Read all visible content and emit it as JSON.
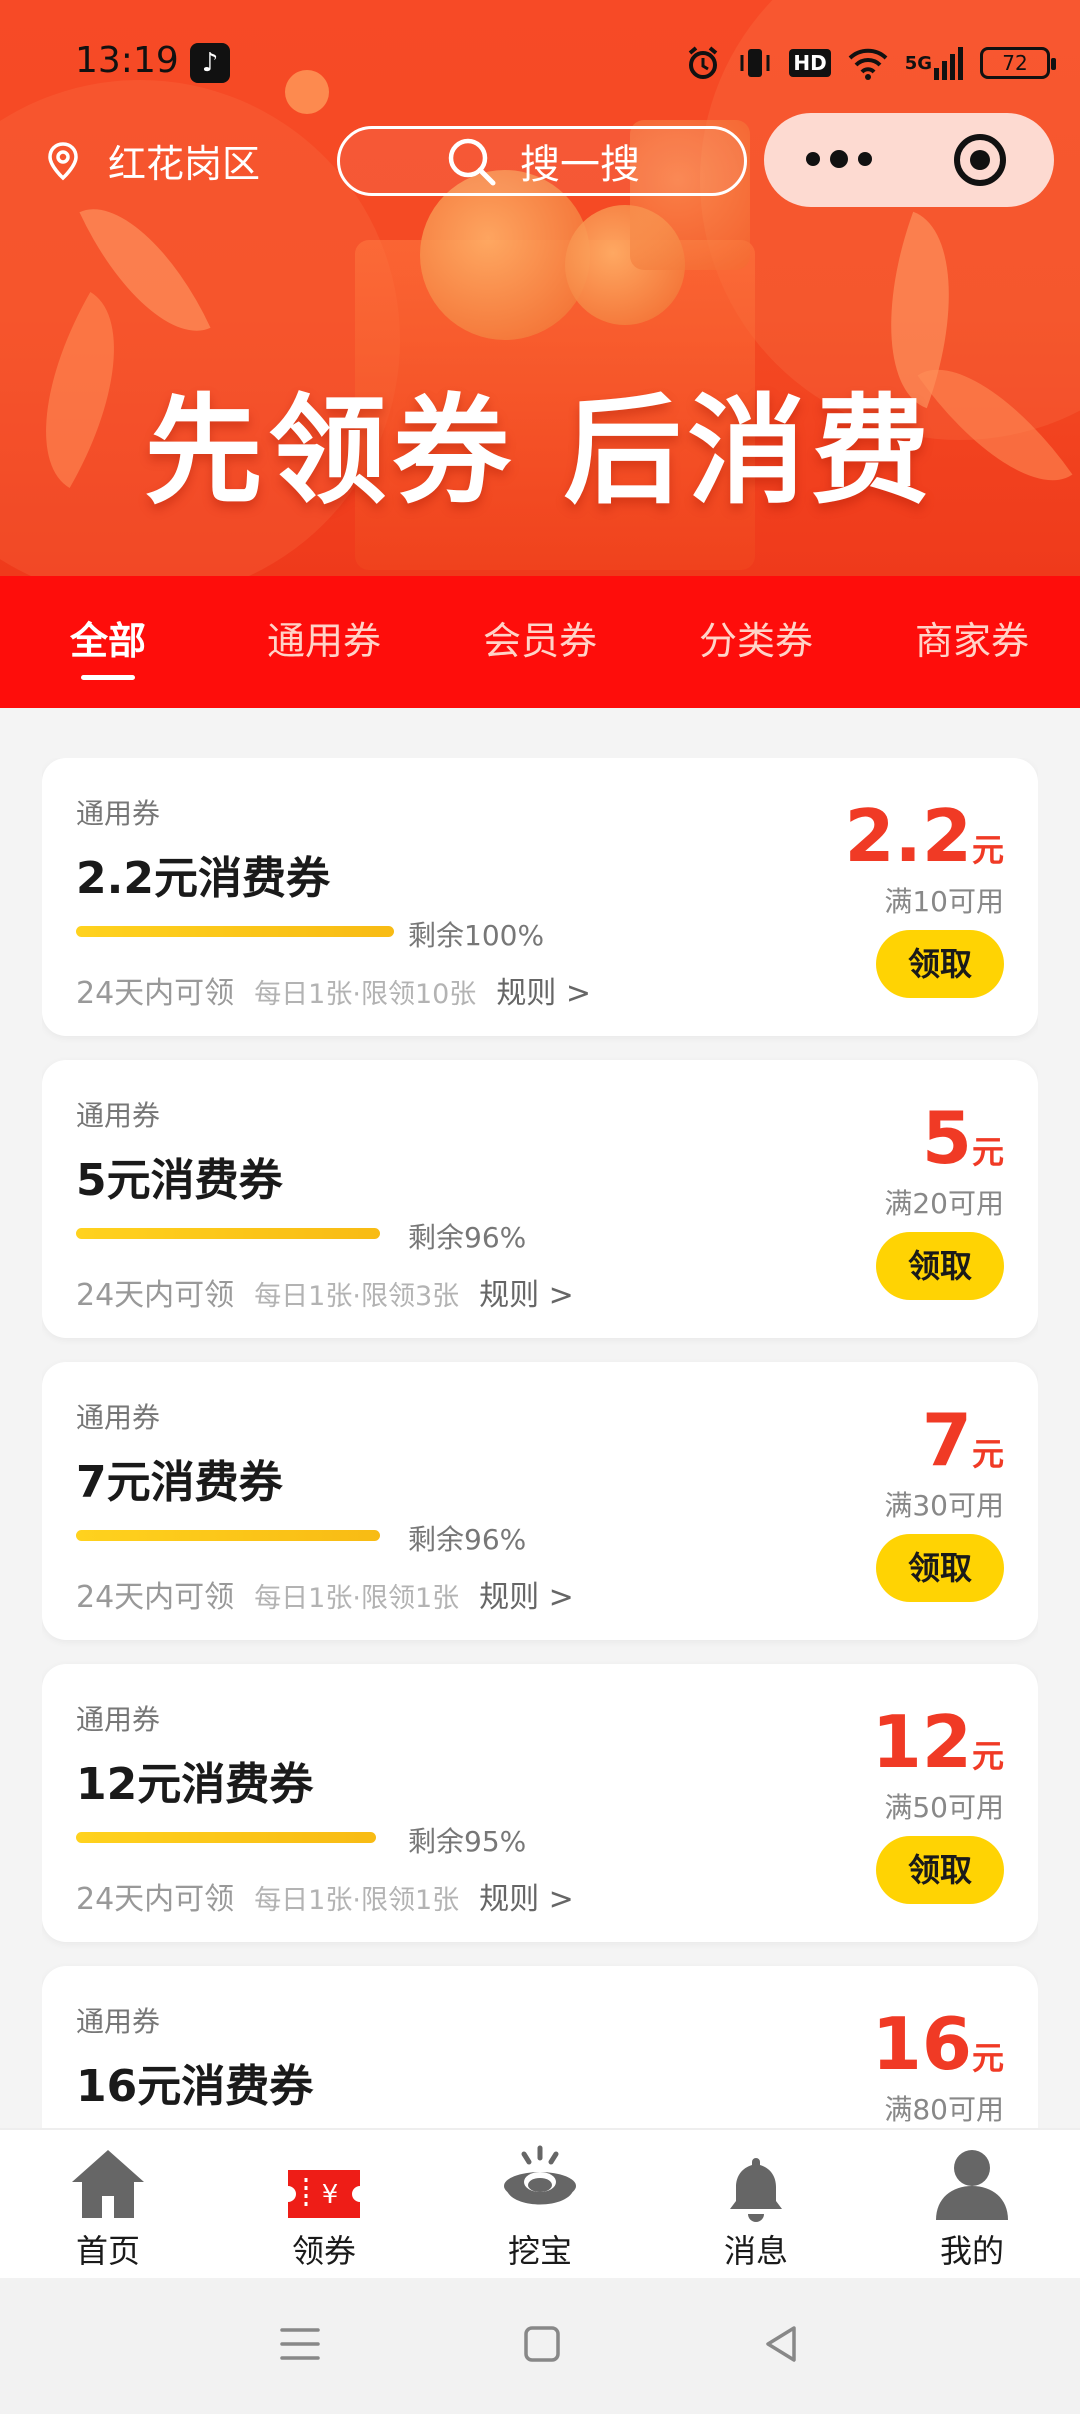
{
  "status_bar": {
    "time": "13:19",
    "network": "5G",
    "hd": "HD",
    "battery": "72"
  },
  "header": {
    "location": "红花岗区",
    "search_placeholder": "搜一搜"
  },
  "banner": {
    "slogan": "先领券 后消费"
  },
  "tabs": [
    {
      "label": "全部",
      "active": true
    },
    {
      "label": "通用券",
      "active": false
    },
    {
      "label": "会员券",
      "active": false
    },
    {
      "label": "分类券",
      "active": false
    },
    {
      "label": "商家券",
      "active": false
    }
  ],
  "coupons": [
    {
      "category": "通用券",
      "title": "2.2元消费券",
      "remaining": "剩余100%",
      "remaining_fraction": 1.0,
      "period": "24天内可领",
      "limit": "每日1张·限领10张",
      "rules": "规则 >",
      "amount": "2.2",
      "unit": "元",
      "condition": "满10可用",
      "button": "领取"
    },
    {
      "category": "通用券",
      "title": "5元消费券",
      "remaining": "剩余96%",
      "remaining_fraction": 0.96,
      "period": "24天内可领",
      "limit": "每日1张·限领3张",
      "rules": "规则 >",
      "amount": "5",
      "unit": "元",
      "condition": "满20可用",
      "button": "领取"
    },
    {
      "category": "通用券",
      "title": "7元消费券",
      "remaining": "剩余96%",
      "remaining_fraction": 0.96,
      "period": "24天内可领",
      "limit": "每日1张·限领1张",
      "rules": "规则 >",
      "amount": "7",
      "unit": "元",
      "condition": "满30可用",
      "button": "领取"
    },
    {
      "category": "通用券",
      "title": "12元消费券",
      "remaining": "剩余95%",
      "remaining_fraction": 0.95,
      "period": "24天内可领",
      "limit": "每日1张·限领1张",
      "rules": "规则 >",
      "amount": "12",
      "unit": "元",
      "condition": "满50可用",
      "button": "领取"
    },
    {
      "category": "通用券",
      "title": "16元消费券",
      "remaining": "",
      "remaining_fraction": null,
      "period": "",
      "limit": "",
      "rules": "",
      "amount": "16",
      "unit": "元",
      "condition": "满80可用",
      "button": ""
    }
  ],
  "bottom_nav": [
    {
      "label": "首页",
      "icon": "home-icon"
    },
    {
      "label": "领券",
      "icon": "coupon-ticket-icon",
      "active": true,
      "icon_text": "¥"
    },
    {
      "label": "挖宝",
      "icon": "treasure-icon"
    },
    {
      "label": "消息",
      "icon": "bell-icon"
    },
    {
      "label": "我的",
      "icon": "profile-icon"
    }
  ],
  "colors": {
    "primary_red": "#fe0d0b",
    "price_red": "#f03a25",
    "button_yellow": "#ffd303",
    "progress_yellow": "#f8bb14"
  }
}
